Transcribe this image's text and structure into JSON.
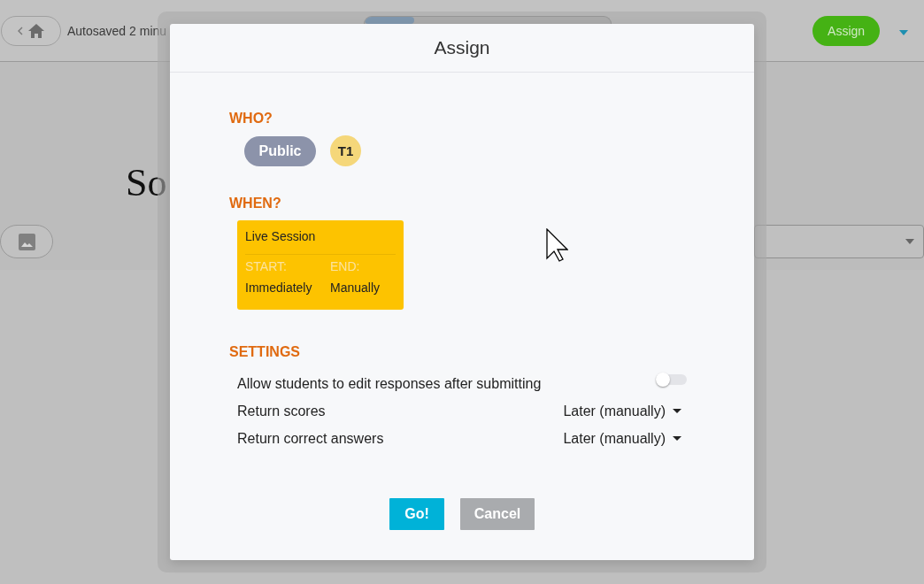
{
  "app_bar": {
    "autosave_text": "Autosaved 2 minu",
    "assign_button": "Assign"
  },
  "header": {
    "title": "So"
  },
  "dialog": {
    "title": "Assign",
    "who": {
      "heading": "WHO?",
      "chips": [
        {
          "label": "Public",
          "kind": "pill"
        },
        {
          "label": "T1",
          "kind": "circle"
        }
      ]
    },
    "when": {
      "heading": "WHEN?",
      "card": {
        "title": "Live Session",
        "start_label": "START:",
        "end_label": "END:",
        "start_value": "Immediately",
        "end_value": "Manually"
      }
    },
    "settings": {
      "heading": "SETTINGS",
      "rows": [
        {
          "kind": "toggle",
          "label": "Allow students to edit responses after submitting",
          "on": false
        },
        {
          "kind": "dropdown",
          "label": "Return scores",
          "value": "Later (manually)"
        },
        {
          "kind": "dropdown",
          "label": "Return correct answers",
          "value": "Later (manually)"
        }
      ]
    },
    "buttons": [
      {
        "label": "Go!",
        "kind": "primary"
      },
      {
        "label": "Cancel",
        "kind": "secondary"
      }
    ]
  }
}
